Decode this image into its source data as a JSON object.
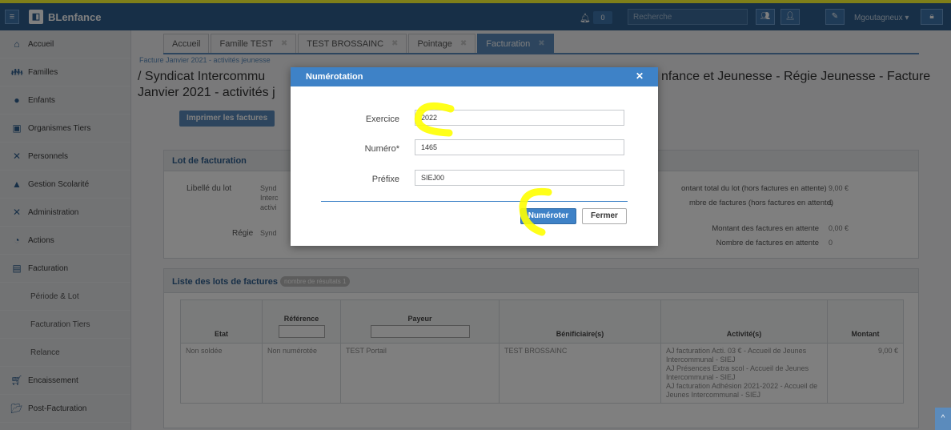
{
  "app": {
    "brand": "BLenfance",
    "notif_count": "0",
    "search_placeholder": "Recherche",
    "user": "Mgoutagneux"
  },
  "sidebar": [
    {
      "label": "Accueil",
      "icon": "home-icon"
    },
    {
      "label": "Familles",
      "icon": "users-icon"
    },
    {
      "label": "Enfants",
      "icon": "user-icon"
    },
    {
      "label": "Organismes Tiers",
      "icon": "briefcase-icon"
    },
    {
      "label": "Personnels",
      "icon": "tools-icon"
    },
    {
      "label": "Gestion Scolarité",
      "icon": "graduation-icon"
    },
    {
      "label": "Administration",
      "icon": "tools-icon"
    },
    {
      "label": "Actions",
      "icon": "gauge-icon"
    },
    {
      "label": "Facturation",
      "icon": "money-icon"
    },
    {
      "label": "Période & Lot"
    },
    {
      "label": "Facturation Tiers"
    },
    {
      "label": "Relance"
    },
    {
      "label": "Encaissement",
      "icon": "cart-icon"
    },
    {
      "label": "Post-Facturation",
      "icon": "folder-icon"
    }
  ],
  "tabs": [
    {
      "label": "Accueil",
      "closable": false
    },
    {
      "label": "Famille TEST",
      "closable": true
    },
    {
      "label": "TEST BROSSAINC",
      "closable": true
    },
    {
      "label": "Pointage",
      "closable": true
    },
    {
      "label": "Facturation",
      "closable": true,
      "active": true
    }
  ],
  "breadcrumb": "Facture Janvier 2021 - activités jeunesse",
  "title": {
    "left_line1": "/ Syndicat Intercommu",
    "left_line2": "Janvier 2021 - activités j",
    "right_line1": "nfance et Jeunesse - Régie Jeunesse - Facture"
  },
  "print_button": "Imprimer les factures",
  "lot": {
    "header": "Lot de facturation",
    "libelle_label": "Libellé du lot",
    "libelle_value": [
      "Synd",
      "Interc",
      "activi"
    ],
    "regie_label": "Régie",
    "regie_value": "Synd",
    "stats": [
      {
        "label": "ontant total du lot (hors factures en attente)",
        "value": "9,00 €"
      },
      {
        "label": "mbre de factures (hors factures en attente)",
        "value": "1"
      },
      {
        "label": "Montant des factures en attente",
        "value": "0,00 €"
      },
      {
        "label": "Nombre de factures en attente",
        "value": "0"
      }
    ]
  },
  "list": {
    "header": "Liste des lots de factures",
    "badge": "nombre de résultats 1",
    "columns": [
      "Etat",
      "Référence",
      "Payeur",
      "Bénificiaire(s)",
      "Activité(s)",
      "Montant"
    ],
    "row": {
      "etat": "Non soldée",
      "reference": "Non numérotée",
      "payeur": "TEST Portail",
      "beneficiaire": "TEST BROSSAINC",
      "activites": [
        "AJ facturation Acti. 03 € - Accueil de Jeunes Intercommunal - SIEJ",
        "AJ Présences Extra scol - Accueil de Jeunes Intercommunal - SIEJ",
        "AJ facturation Adhésion 2021-2022 - Accueil de Jeunes Intercommunal - SIEJ"
      ],
      "montant": "9,00 €"
    }
  },
  "modal": {
    "title": "Numérotation",
    "fields": [
      {
        "label": "Exercice",
        "value": "2022"
      },
      {
        "label": "Numéro*",
        "value": "1465"
      },
      {
        "label": "Préfixe",
        "value": "SIEJ00"
      }
    ],
    "confirm": "Numéroter",
    "cancel": "Fermer"
  },
  "colors": {
    "primary": "#3e82c7",
    "topbar": "#2f5f8f",
    "highlight": "#ffff33"
  }
}
